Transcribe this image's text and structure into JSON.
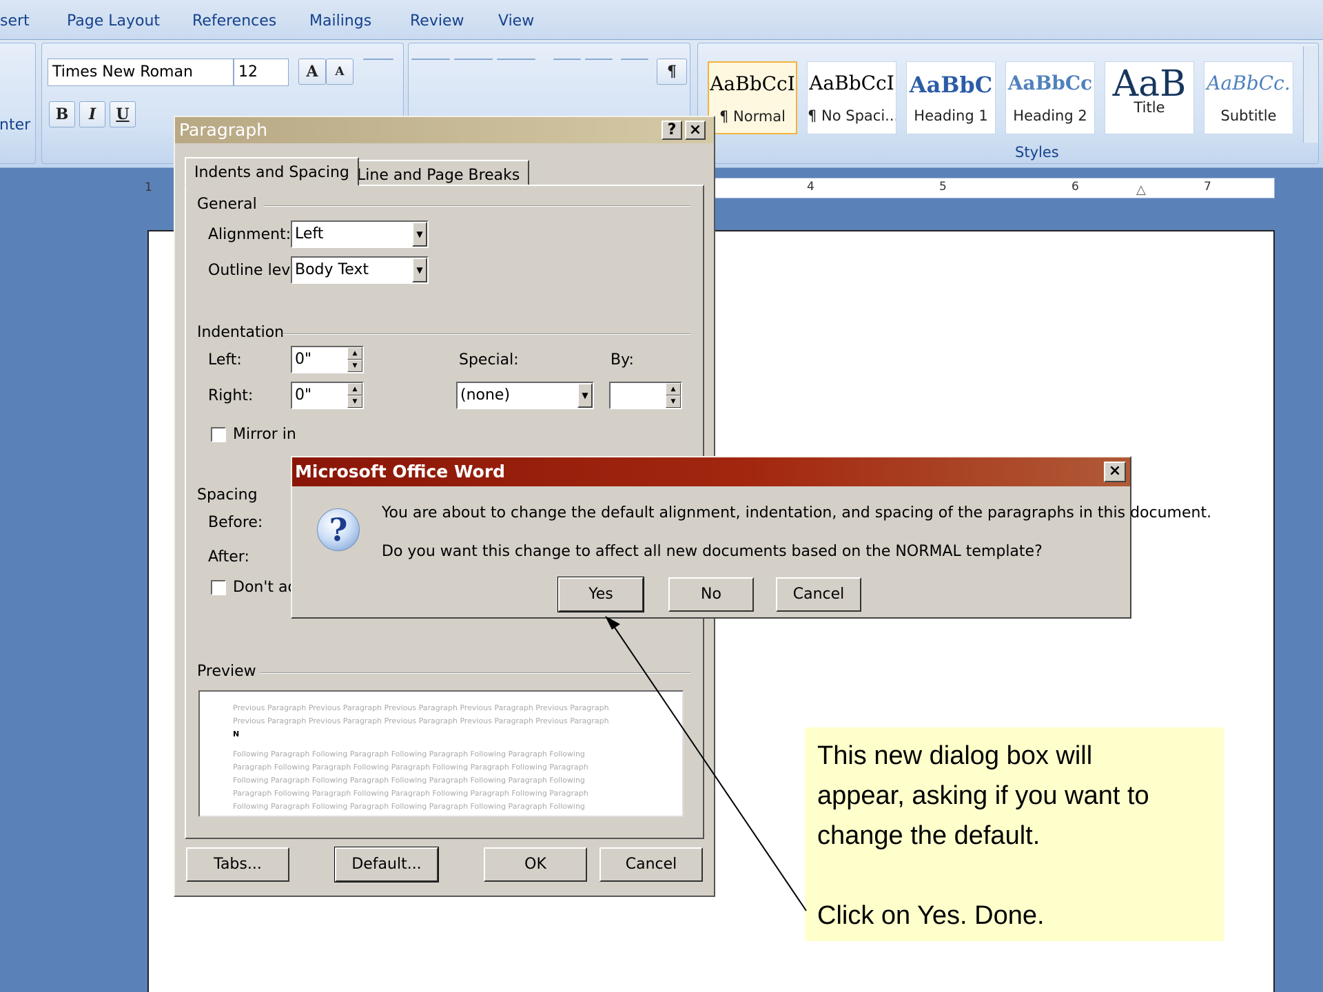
{
  "ribbon": {
    "tabs": [
      "sert",
      "Page Layout",
      "References",
      "Mailings",
      "Review",
      "View"
    ],
    "font_name": "Times New Roman",
    "font_size": "12",
    "group_left_label": "nter",
    "styles_label": "Styles",
    "styles": [
      {
        "sample": "AaBbCcI",
        "name": "¶ Normal",
        "selected": true
      },
      {
        "sample": "AaBbCcI",
        "name": "¶ No Spaci..."
      },
      {
        "sample": "AaBbC",
        "name": "Heading 1"
      },
      {
        "sample": "AaBbCc",
        "name": "Heading 2"
      },
      {
        "sample": "AaB",
        "name": "Title"
      },
      {
        "sample": "AaBbCc.",
        "name": "Subtitle"
      }
    ],
    "buttons": {
      "bold": "B",
      "italic": "I",
      "underline": "U",
      "grow_font": "A",
      "shrink_font": "A",
      "pilcrow": "¶"
    }
  },
  "ruler": {
    "left_number": "1",
    "numbers": [
      "4",
      "5",
      "6",
      "7"
    ]
  },
  "paragraph_dialog": {
    "title": "Paragraph",
    "help": "?",
    "close": "×",
    "tabs": [
      "Indents and Spacing",
      "Line and Page Breaks"
    ],
    "general_label": "General",
    "alignment_label": "Alignment:",
    "alignment_value": "Left",
    "outline_label": "Outline level:",
    "outline_value": "Body Text",
    "indentation_label": "Indentation",
    "left_label": "Left:",
    "left_value": "0\"",
    "right_label": "Right:",
    "right_value": "0\"",
    "special_label": "Special:",
    "special_value": "(none)",
    "by_label": "By:",
    "by_value": "",
    "mirror_label": "Mirror in",
    "spacing_label": "Spacing",
    "before_label": "Before:",
    "after_label": "After:",
    "dont_add_label": "Don't ad",
    "preview_label": "Preview",
    "preview_lines": [
      "Previous Paragraph Previous Paragraph Previous Paragraph Previous Paragraph Previous Paragraph",
      "Previous Paragraph Previous Paragraph Previous Paragraph Previous Paragraph Previous Paragraph",
      "N",
      "Following Paragraph Following Paragraph Following Paragraph Following Paragraph Following",
      "Paragraph Following Paragraph Following Paragraph Following Paragraph Following Paragraph",
      "Following Paragraph Following Paragraph Following Paragraph Following Paragraph Following",
      "Paragraph Following Paragraph Following Paragraph Following Paragraph Following Paragraph",
      "Following Paragraph Following Paragraph Following Paragraph Following Paragraph Following"
    ],
    "buttons": {
      "tabs": "Tabs...",
      "default": "Default...",
      "ok": "OK",
      "cancel": "Cancel"
    }
  },
  "message_box": {
    "title": "Microsoft Office Word",
    "close": "×",
    "icon": "?",
    "line1": "You are about to change the default alignment, indentation, and spacing of the paragraphs in this document.",
    "line2": "Do you want this change to affect all new documents based on the NORMAL template?",
    "buttons": {
      "yes": "Yes",
      "no": "No",
      "cancel": "Cancel"
    }
  },
  "callout": {
    "lines": [
      "This new dialog box will",
      "appear, asking if you want to",
      "change the default.",
      "",
      "Click on Yes.  Done."
    ]
  },
  "colors": {
    "ribbon_text": "#15428b",
    "message_title": "#a3270f",
    "callout_bg": "#ffffcc",
    "desktop": "#5b82b8"
  }
}
